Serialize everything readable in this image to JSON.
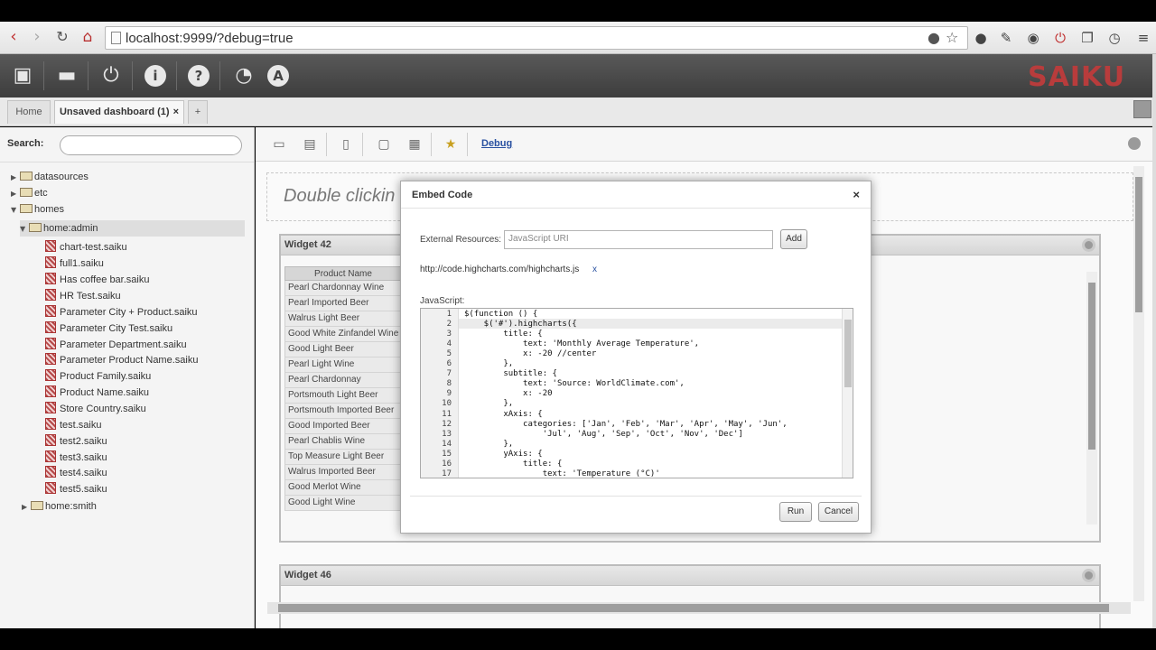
{
  "browser": {
    "url": "localhost:9999/?debug=true"
  },
  "app": {
    "logo_text": "SAIKU",
    "toolbar_icons": [
      "new-query-icon",
      "open-query-icon",
      "logout-icon",
      "info-icon",
      "help-icon",
      "dashboard-icon",
      "admin-icon"
    ]
  },
  "tabs": [
    {
      "label": "Home"
    },
    {
      "label": "Unsaved dashboard (1)",
      "close": "×"
    },
    {
      "label": "+"
    }
  ],
  "sidebar": {
    "search_label": "Search:",
    "search_placeholder": "",
    "tree": [
      {
        "label": "datasources"
      },
      {
        "label": "etc"
      },
      {
        "label": "homes"
      },
      {
        "label": "home:admin"
      },
      {
        "label": "chart-test.saiku"
      },
      {
        "label": "full1.saiku"
      },
      {
        "label": "Has coffee bar.saiku"
      },
      {
        "label": "HR Test.saiku"
      },
      {
        "label": "Parameter City + Product.saiku"
      },
      {
        "label": "Parameter City Test.saiku"
      },
      {
        "label": "Parameter Department.saiku"
      },
      {
        "label": "Parameter Product Name.saiku"
      },
      {
        "label": "Product Family.saiku"
      },
      {
        "label": "Product Name.saiku"
      },
      {
        "label": "Store Country.saiku"
      },
      {
        "label": "test.saiku"
      },
      {
        "label": "test2.saiku"
      },
      {
        "label": "test3.saiku"
      },
      {
        "label": "test4.saiku"
      },
      {
        "label": "test5.saiku"
      },
      {
        "label": "home:smith"
      }
    ]
  },
  "main": {
    "debug_label": "Debug",
    "dropzone_text": "Double clickin",
    "widget1": {
      "title": "Widget 42",
      "column_header": "Product Name",
      "rows": [
        "Pearl Chardonnay Wine",
        "Pearl Imported Beer",
        "Walrus Light Beer",
        "Good White Zinfandel Wine",
        "Good Light Beer",
        "Pearl Light Wine",
        "Pearl Chardonnay",
        "Portsmouth Light Beer",
        "Portsmouth Imported Beer",
        "Good Imported Beer",
        "Pearl Chablis Wine",
        "Top Measure Light Beer",
        "Walrus Imported Beer",
        "Good Merlot Wine",
        "Good Light Wine"
      ]
    },
    "widget2": {
      "title": "Widget 46"
    }
  },
  "modal": {
    "title": "Embed Code",
    "close": "×",
    "external_label": "External Resources:",
    "uri_placeholder": "JavaScript URI",
    "add_label": "Add",
    "resource_url": "http://code.highcharts.com/highcharts.js",
    "resource_remove": "x",
    "js_label": "JavaScript:",
    "code_lines": [
      "$(function () {",
      "    $('#').highcharts({",
      "        title: {",
      "            text: 'Monthly Average Temperature',",
      "            x: -20 //center",
      "        },",
      "        subtitle: {",
      "            text: 'Source: WorldClimate.com',",
      "            x: -20",
      "        },",
      "        xAxis: {",
      "            categories: ['Jan', 'Feb', 'Mar', 'Apr', 'May', 'Jun',",
      "                'Jul', 'Aug', 'Sep', 'Oct', 'Nov', 'Dec']",
      "        },",
      "        yAxis: {",
      "            title: {",
      "                text: 'Temperature (°C)'"
    ],
    "line_numbers": [
      "1",
      "2",
      "3",
      "4",
      "5",
      "6",
      "7",
      "8",
      "9",
      "10",
      "11",
      "12",
      "13",
      "14",
      "15",
      "16",
      "17"
    ],
    "run_label": "Run",
    "cancel_label": "Cancel"
  }
}
